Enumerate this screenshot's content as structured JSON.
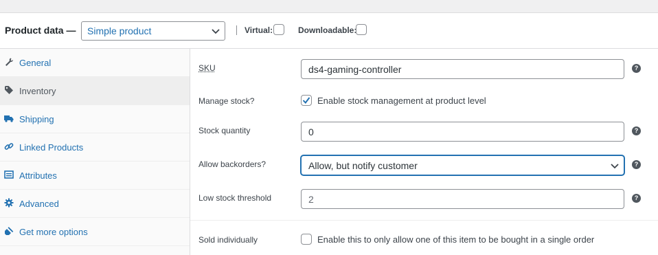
{
  "header": {
    "title": "Product data —",
    "product_type": "Simple product",
    "virtual_label": "Virtual:",
    "downloadable_label": "Downloadable:"
  },
  "sidebar": {
    "tabs": [
      {
        "label": "General",
        "icon": "wrench-icon",
        "active": false
      },
      {
        "label": "Inventory",
        "icon": "tag-icon",
        "active": true
      },
      {
        "label": "Shipping",
        "icon": "truck-icon",
        "active": false
      },
      {
        "label": "Linked Products",
        "icon": "link-icon",
        "active": false
      },
      {
        "label": "Attributes",
        "icon": "list-icon",
        "active": false
      },
      {
        "label": "Advanced",
        "icon": "gear-icon",
        "active": false
      },
      {
        "label": "Get more options",
        "icon": "plugin-icon",
        "active": false
      }
    ]
  },
  "inventory": {
    "sku_label": "SKU",
    "sku_value": "ds4-gaming-controller",
    "manage_stock_label": "Manage stock?",
    "manage_stock_checkbox_label": "Enable stock management at product level",
    "manage_stock_checked": true,
    "stock_qty_label": "Stock quantity",
    "stock_qty_value": "0",
    "backorders_label": "Allow backorders?",
    "backorders_value": "Allow, but notify customer",
    "low_stock_label": "Low stock threshold",
    "low_stock_placeholder": "2",
    "sold_individually_label": "Sold individually",
    "sold_individually_checkbox_label": "Enable this to only allow one of this item to be bought in a single order",
    "help_glyph": "?"
  },
  "colors": {
    "link": "#2271b1",
    "text": "#3c434a",
    "border": "#8c8f94",
    "sidebar_bg": "#fafafa",
    "active_tab_bg": "#eeeeee"
  }
}
